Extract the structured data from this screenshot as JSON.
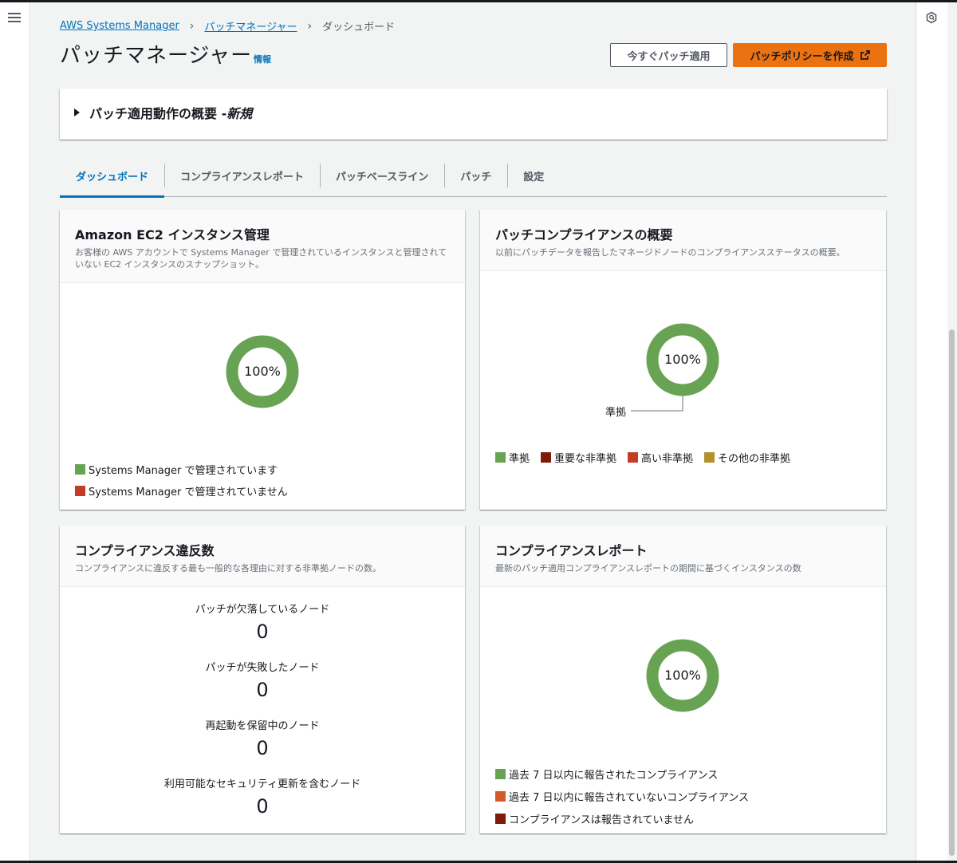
{
  "breadcrumb": {
    "items": [
      "AWS Systems Manager",
      "パッチマネージャー"
    ],
    "current": "ダッシュボード"
  },
  "header": {
    "title": "パッチマネージャー",
    "info": "情報",
    "patch_now": "今すぐパッチ適用",
    "create_policy": "パッチポリシーを作成"
  },
  "overview_panel": {
    "title": "パッチ適用動作の概要 - ",
    "title_emphasis": "新規"
  },
  "tabs": [
    "ダッシュボード",
    "コンプライアンスレポート",
    "パッチベースライン",
    "パッチ",
    "設定"
  ],
  "colors": {
    "green": "#67a353",
    "red": "#d13212",
    "darkred": "#7d1b08",
    "high": "#c33d24",
    "other": "#b1922f",
    "orange": "#d45b27"
  },
  "ec2_card": {
    "title": "Amazon EC2 インスタンス管理",
    "desc1": "お客様の AWS アカウントで Systems Manager で管理されているインスタンスと管理されて",
    "desc2": "いない EC2 インスタンスのスナップショット。",
    "percent": "100%",
    "legend": [
      "Systems Manager で管理されています",
      "Systems Manager で管理されていません"
    ]
  },
  "patch_card": {
    "title": "パッチコンプライアンスの概要",
    "desc": "以前にパッチデータを報告したマネージドノードのコンプライアンスステータスの概要。",
    "percent": "100%",
    "callout": "準拠",
    "legend": [
      "準拠",
      "重要な非準拠",
      "高い非準拠",
      "その他の非準拠"
    ]
  },
  "violation_card": {
    "title": "コンプライアンス違反数",
    "desc": "コンプライアンスに違反する最も一般的な各理由に対する非準拠ノードの数。",
    "metrics": [
      {
        "label": "パッチが欠落しているノード",
        "value": "0"
      },
      {
        "label": "パッチが失敗したノード",
        "value": "0"
      },
      {
        "label": "再起動を保留中のノード",
        "value": "0"
      },
      {
        "label": "利用可能なセキュリティ更新を含むノード",
        "value": "0"
      }
    ]
  },
  "report_card": {
    "title": "コンプライアンスレポート",
    "desc": "最新のパッチ適用コンプライアンスレポートの期間に基づくインスタンスの数",
    "percent": "100%",
    "legend": [
      "過去 7 日以内に報告されたコンプライアンス",
      "過去 7 日以内に報告されていないコンプライアンス",
      "コンプライアンスは報告されていません"
    ]
  }
}
